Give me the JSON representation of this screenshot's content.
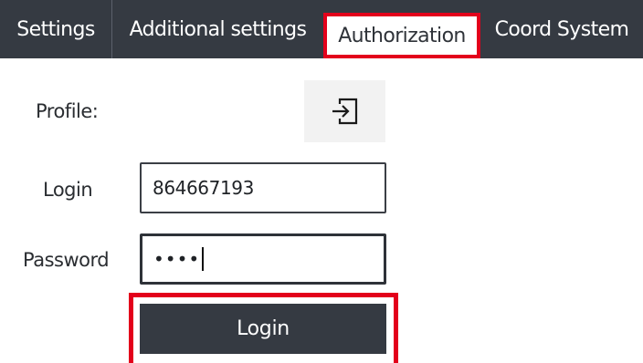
{
  "tabs": [
    {
      "label": "Settings"
    },
    {
      "label": "Additional settings"
    },
    {
      "label": "Authorization",
      "active": true
    },
    {
      "label": "Coord System"
    }
  ],
  "form": {
    "profile_label": "Profile:",
    "profile_icon": "login-arrow-icon",
    "login_label": "Login",
    "login_value": "864667193",
    "password_label": "Password",
    "password_masked": "••••",
    "login_button_label": "Login"
  },
  "colors": {
    "tabbar_bg": "#353a42",
    "highlight": "#e3001b",
    "button_bg": "#353a42"
  }
}
